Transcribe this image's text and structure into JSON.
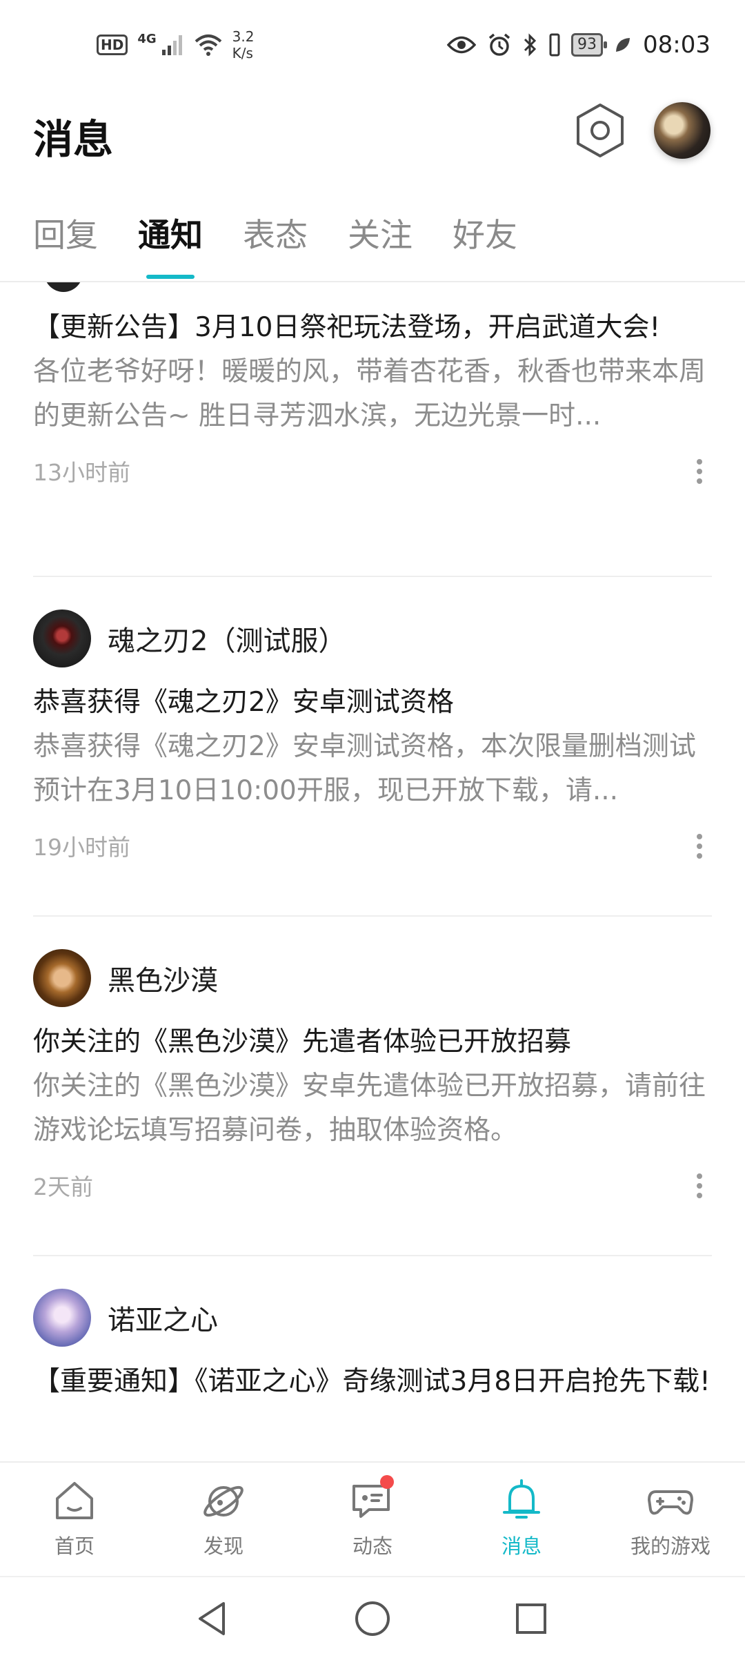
{
  "status_bar": {
    "left_badges": [
      "HD",
      "4G"
    ],
    "net_speed": "3.2",
    "net_speed_unit": "K/s",
    "battery": "93",
    "time": "08:03",
    "icons": [
      "hd-icon",
      "signal-icon",
      "wifi-icon",
      "eye-icon",
      "alarm-icon",
      "bluetooth-icon",
      "vibrate-icon",
      "battery-icon",
      "leaf-icon"
    ]
  },
  "header": {
    "title": "消息"
  },
  "tabs": [
    {
      "label": "回复",
      "active": false
    },
    {
      "label": "通知",
      "active": true
    },
    {
      "label": "表态",
      "active": false
    },
    {
      "label": "关注",
      "active": false
    },
    {
      "label": "好友",
      "active": false
    }
  ],
  "notifications": [
    {
      "source": "",
      "title": "【更新公告】3月10日祭祀玩法登场，开启武道大会!",
      "summary": "各位老爷好呀！暖暖的风，带着杏花香，秋香也带来本周的更新公告~ 胜日寻芳泗水滨，无边光景一时...",
      "time": "13小时前"
    },
    {
      "source": "魂之刃2（测试服）",
      "title": "恭喜获得《魂之刃2》安卓测试资格",
      "summary": "恭喜获得《魂之刃2》安卓测试资格，本次限量删档测试预计在3月10日10:00开服，现已开放下载，请...",
      "time": "19小时前"
    },
    {
      "source": "黑色沙漠",
      "title": "你关注的《黑色沙漠》先遣者体验已开放招募",
      "summary": "你关注的《黑色沙漠》安卓先遣体验已开放招募，请前往游戏论坛填写招募问卷，抽取体验资格。",
      "time": "2天前"
    },
    {
      "source": "诺亚之心",
      "title": "【重要通知】《诺亚之心》奇缘测试3月8日开启抢先下载!",
      "summary": "",
      "time": ""
    }
  ],
  "bottom_nav": [
    {
      "label": "首页",
      "icon": "home-icon",
      "active": false
    },
    {
      "label": "发现",
      "icon": "discover-icon",
      "active": false
    },
    {
      "label": "动态",
      "icon": "feed-icon",
      "active": false,
      "badge": true
    },
    {
      "label": "消息",
      "icon": "bell-icon",
      "active": true
    },
    {
      "label": "我的游戏",
      "icon": "gamepad-icon",
      "active": false
    }
  ],
  "colors": {
    "accent": "#14b9c8",
    "badge": "#f44b4b",
    "text_primary": "#1a1a1a",
    "text_secondary": "#8d8d8d",
    "text_tertiary": "#a9a9a9"
  }
}
